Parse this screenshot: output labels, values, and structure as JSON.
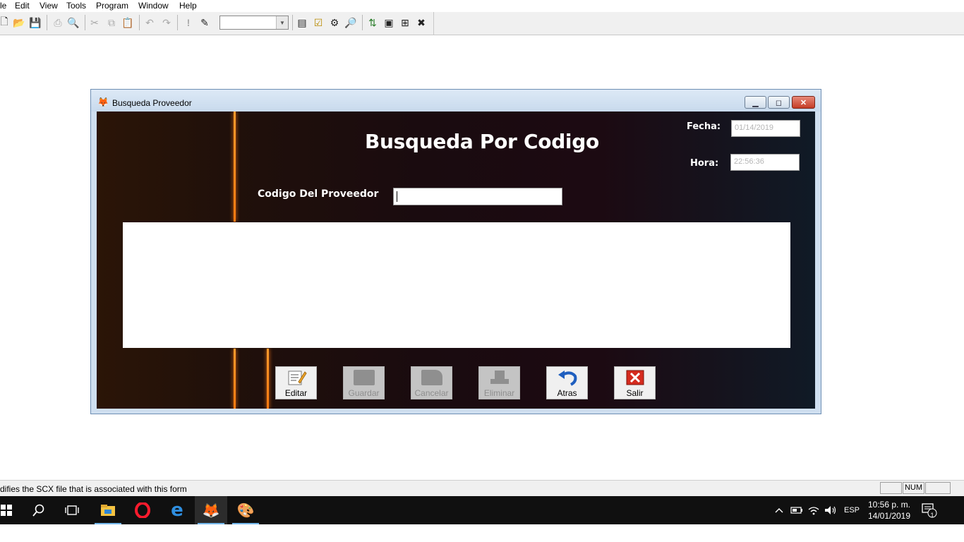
{
  "menubar": {
    "items": [
      "le",
      "Edit",
      "View",
      "Tools",
      "Program",
      "Window",
      "Help"
    ]
  },
  "toolbar": {
    "icons": [
      "new-file-icon",
      "open-folder-icon",
      "save-icon",
      "print-icon",
      "print-preview-icon",
      "cut-icon",
      "copy-icon",
      "paste-icon",
      "undo-icon",
      "redo-icon",
      "run-icon",
      "form-designer-icon",
      "data-session-icon",
      "properties-icon",
      "code-icon",
      "class-browser-icon",
      "document-view-icon",
      "command-window-icon",
      "builder-icon",
      "tools-icon"
    ],
    "combo_value": ""
  },
  "window": {
    "title": "Busqueda Proveedor",
    "heading": "Busqueda Por Codigo",
    "fecha_label": "Fecha:",
    "fecha_value": "01/14/2019",
    "hora_label": "Hora:",
    "hora_value": "22:56:36",
    "codigo_label": "Codigo Del Proveedor",
    "codigo_value": "",
    "buttons": {
      "editar": "Editar",
      "guardar": "Guardar",
      "cancelar": "Cancelar",
      "eliminar": "Eliminar",
      "atras": "Atras",
      "salir": "Salir"
    },
    "colors": {
      "stripe": "#ff8a1e",
      "close": "#c43c26"
    }
  },
  "statusbar": {
    "message": "difies the SCX file that is associated with this form",
    "num": "NUM"
  },
  "taskbar": {
    "apps": [
      "windows-start-icon",
      "search-icon",
      "task-view-icon",
      "file-explorer-icon",
      "opera-icon",
      "edge-icon",
      "visual-foxpro-icon",
      "paint-icon"
    ],
    "lang": "ESP",
    "time": "10:56 p. m.",
    "date": "14/01/2019",
    "notifications": "1"
  }
}
